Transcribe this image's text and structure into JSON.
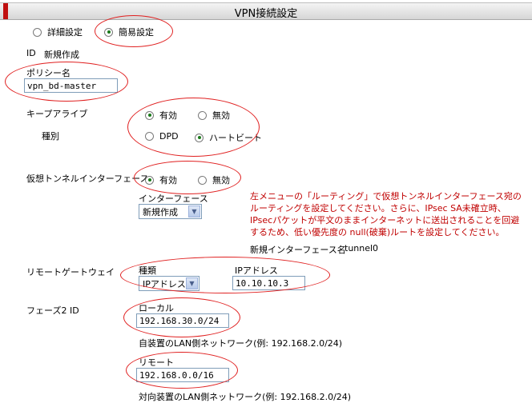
{
  "header": {
    "title": "VPN接続設定"
  },
  "mode": {
    "detail_label": "詳細設定",
    "simple_label": "簡易設定",
    "selected": "simple"
  },
  "id_row": {
    "label": "ID",
    "value": "新規作成"
  },
  "policy": {
    "label": "ポリシー名",
    "value": "vpn_bd-master"
  },
  "keepalive": {
    "label": "キープアライブ",
    "enabled_label": "有効",
    "disabled_label": "無効",
    "selected": "enabled",
    "type_label": "種別",
    "dpd_label": "DPD",
    "heartbeat_label": "ハートビート",
    "type_selected": "heartbeat"
  },
  "virtual_tunnel": {
    "label": "仮想トンネルインターフェース",
    "enabled_label": "有効",
    "disabled_label": "無効",
    "selected": "enabled",
    "interface_label": "インターフェース",
    "interface_value": "新規作成",
    "note_lines": [
      "左メニューの「ルーティング」で仮想トンネルインターフェース宛の",
      "ルーティングを設定してください。さらに、IPsec SA未確立時、",
      "IPsecパケットが平文のままインターネットに送出されることを回避",
      "するため、低い優先度の null(破棄)ルートを設定してください。"
    ],
    "new_interface_label": "新規インターフェース名",
    "new_interface_value": "tunnel0"
  },
  "remote_gateway": {
    "label": "リモートゲートウェイ",
    "type_label": "種類",
    "type_value": "IPアドレス",
    "ip_label": "IPアドレス",
    "ip_value": "10.10.10.3"
  },
  "phase2": {
    "label": "フェーズ2 ID",
    "local_label": "ローカル",
    "local_value": "192.168.30.0/24",
    "local_help": "自装置のLAN側ネットワーク(例: 192.168.2.0/24)",
    "remote_label": "リモート",
    "remote_value": "192.168.0.0/16",
    "remote_help": "対向装置のLAN側ネットワーク(例: 192.168.2.0/24)"
  },
  "annotation_color": "#e02020",
  "note_color": "#c00000"
}
